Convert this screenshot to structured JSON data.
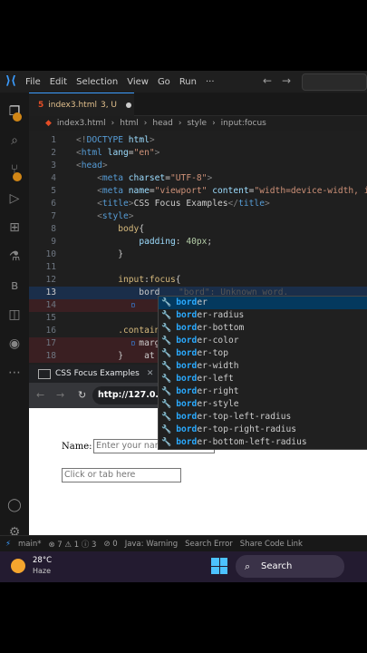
{
  "titlebar": {
    "menus": [
      "File",
      "Edit",
      "Selection",
      "View",
      "Go",
      "Run",
      "···"
    ]
  },
  "tab": {
    "title": "index3.html",
    "status": "3, U"
  },
  "breadcrumb": [
    "index3.html",
    "html",
    "head",
    "style",
    "input:focus"
  ],
  "editor": {
    "lines": [
      {
        "n": "1",
        "html": "<span class='gy'>&lt;!</span><span class='tg'>DOCTYPE</span> <span class='at'>html</span><span class='gy'>&gt;</span>"
      },
      {
        "n": "2",
        "html": "<span class='gy'>&lt;</span><span class='tg'>html</span> <span class='at'>lang</span>=<span class='st'>\"en\"</span><span class='gy'>&gt;</span>"
      },
      {
        "n": "3",
        "html": "<span class='gy'>&lt;</span><span class='tg'>head</span><span class='gy'>&gt;</span>"
      },
      {
        "n": "4",
        "html": "    <span class='gy'>&lt;</span><span class='tg'>meta</span> <span class='at'>charset</span>=<span class='st'>\"UTF-8\"</span><span class='gy'>&gt;</span>"
      },
      {
        "n": "5",
        "html": "    <span class='gy'>&lt;</span><span class='tg'>meta</span> <span class='at'>name</span>=<span class='st'>\"viewport\"</span> <span class='at'>content</span>=<span class='st'>\"width=device-width, in</span>"
      },
      {
        "n": "6",
        "html": "    <span class='gy'>&lt;</span><span class='tg'>title</span><span class='gy'>&gt;</span>CSS Focus Examples<span class='gy'>&lt;/</span><span class='tg'>title</span><span class='gy'>&gt;</span>"
      },
      {
        "n": "7",
        "html": "    <span class='gy'>&lt;</span><span class='tg'>style</span><span class='gy'>&gt;</span>"
      },
      {
        "n": "8",
        "html": "        <span class='sel'>body</span>{"
      },
      {
        "n": "9",
        "html": "            <span class='pr'>padding</span>: <span class='nm'>40px</span>;"
      },
      {
        "n": "10",
        "html": "        }"
      },
      {
        "n": "11",
        "html": ""
      },
      {
        "n": "12",
        "html": "        <span class='sel'>input</span>:<span class='sel'>focus</span>{"
      },
      {
        "n": "13",
        "html": "            bord"
      },
      {
        "n": "14",
        "html": "                col"
      },
      {
        "n": "15",
        "html": ""
      },
      {
        "n": "16",
        "html": "        <span class='sel'>.contain</span>"
      },
      {
        "n": "17",
        "html": "            marg"
      },
      {
        "n": "18",
        "html": "        }    at"
      }
    ],
    "diagnostic": "\"bord\": Unknown word."
  },
  "suggestions": [
    "border",
    "border-radius",
    "border-bottom",
    "border-color",
    "border-top",
    "border-width",
    "border-left",
    "border-right",
    "border-style",
    "border-top-left-radius",
    "border-top-right-radius",
    "border-bottom-left-radius"
  ],
  "suggest_match": "bord",
  "browser": {
    "tab_title": "CSS Focus Examples",
    "url": "http://127.0.0.1",
    "form": {
      "name_label": "Name:",
      "name_placeholder": "Enter your name",
      "tab_placeholder": "Click or tab here"
    }
  },
  "statusbar": [
    "main*",
    "⊗ 7 ⚠ 1 ⓘ 3",
    "⊘ 0",
    "Java: Warning",
    "Search Error",
    "Share Code Link"
  ],
  "taskbar": {
    "temp": "28°C",
    "condition": "Haze",
    "search": "Search"
  }
}
